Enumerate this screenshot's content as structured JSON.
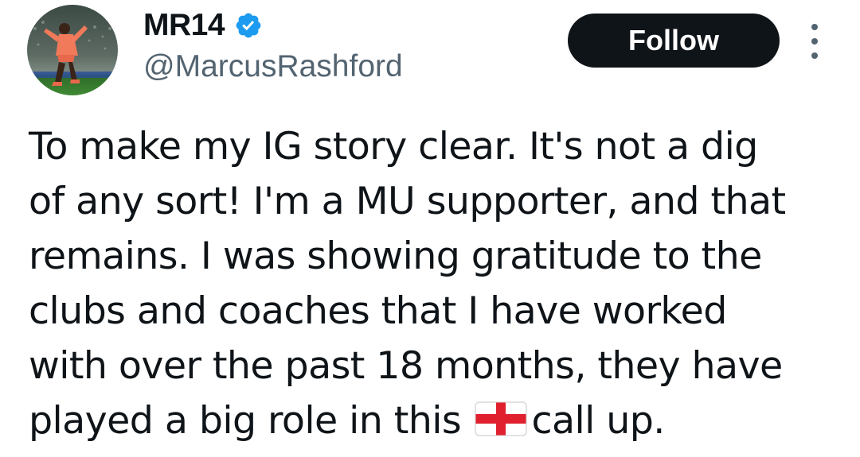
{
  "profile": {
    "display_name": "MR14",
    "handle": "@MarcusRashford",
    "verified": true,
    "avatar_icon": "player-celebrating-avatar",
    "verified_icon": "verified-badge-icon",
    "verified_color": "#1d9bf0"
  },
  "actions": {
    "follow_label": "Follow",
    "more_icon": "more-vertical-icon"
  },
  "tweet": {
    "lines": [
      "To make my IG story clear. It's not a dig",
      "of any sort! I'm a MU supporter, and that",
      "remains. I was showing gratitude to the",
      "clubs and coaches that I have worked",
      "with over the past 18 months, they have"
    ],
    "last_line_before_flag": "played a big role in this",
    "flag_icon": "england-flag-icon",
    "last_line_after_flag": "call up."
  },
  "colors": {
    "text": "#0f1419",
    "secondary": "#536471",
    "button_bg": "#0f1419",
    "button_text": "#ffffff"
  }
}
